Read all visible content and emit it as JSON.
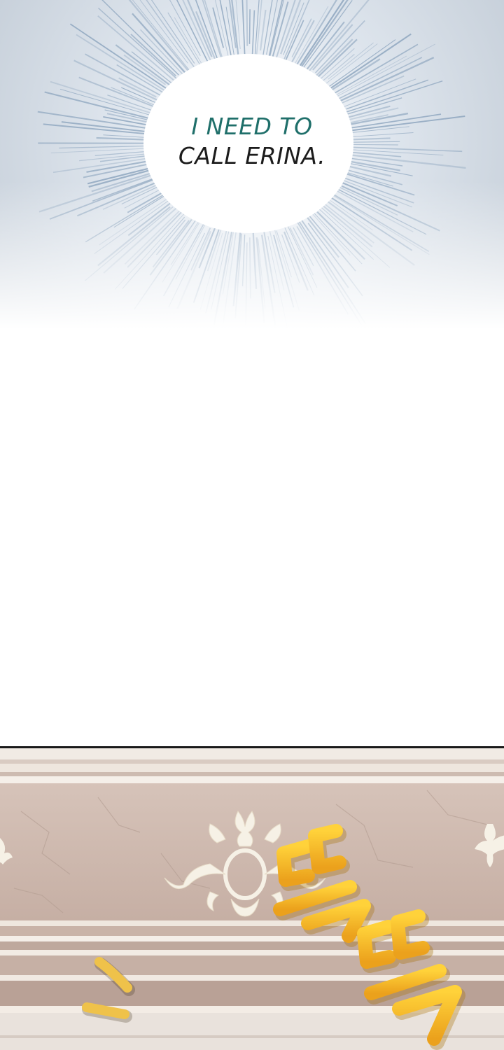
{
  "panel_top": {
    "thought_line1": "I NEED TO",
    "thought_line2": "CALL ERINA."
  },
  "panel_bottom": {
    "sfx_text": "똑똑",
    "colors": {
      "wall": "#cdb8ae",
      "trim": "#f3ece4",
      "ornament": "#f6f1e6",
      "sfx": "#f2b526"
    }
  },
  "colors": {
    "burst_blue": "#8ea6bf",
    "text_teal": "#1f6f6a",
    "text_dark": "#1c1c1c"
  }
}
